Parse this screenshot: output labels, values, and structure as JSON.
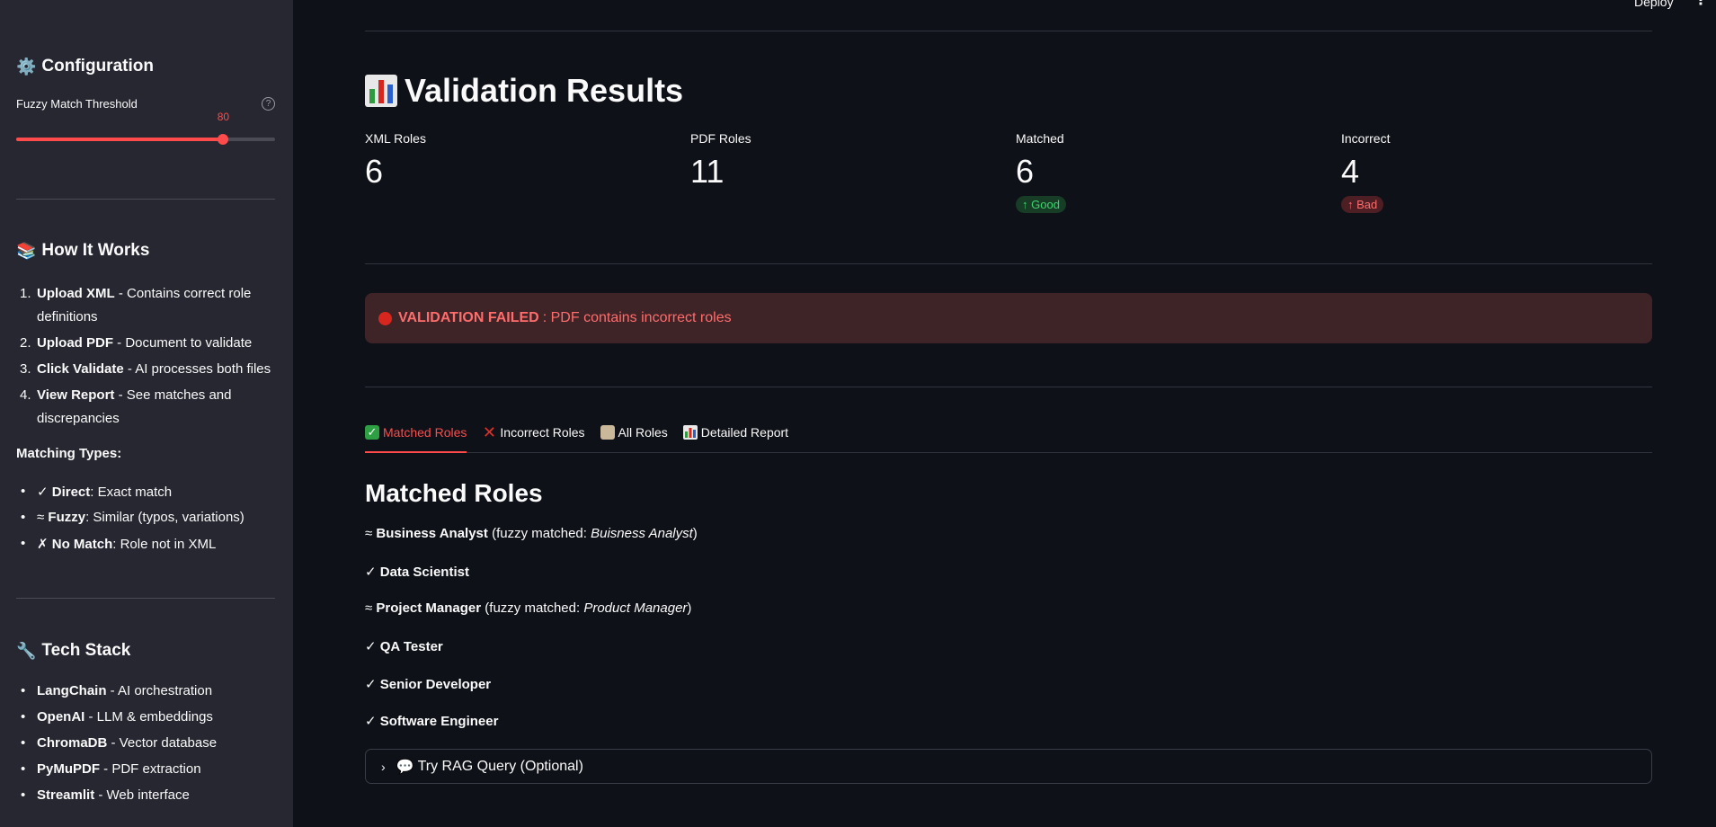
{
  "sidebar": {
    "config_title": "Configuration",
    "slider": {
      "label": "Fuzzy Match Threshold",
      "value": "80",
      "min": 0,
      "max": 100
    },
    "how_title": "How It Works",
    "steps": [
      {
        "num": "1.",
        "bold": "Upload XML",
        "rest": " - Contains correct role definitions"
      },
      {
        "num": "2.",
        "bold": "Upload PDF",
        "rest": " - Document to validate"
      },
      {
        "num": "3.",
        "bold": "Click Validate",
        "rest": " - AI processes both files"
      },
      {
        "num": "4.",
        "bold": "View Report",
        "rest": " - See matches and discrepancies"
      }
    ],
    "matching_title": "Matching Types:",
    "matching": [
      {
        "sym": "✓",
        "bold": "Direct",
        "rest": ": Exact match"
      },
      {
        "sym": "≈",
        "bold": "Fuzzy",
        "rest": ": Similar (typos, variations)"
      },
      {
        "sym": "✗",
        "bold": "No Match",
        "rest": ": Role not in XML"
      }
    ],
    "tech_title": "Tech Stack",
    "tech": [
      {
        "bold": "LangChain",
        "rest": " - AI orchestration"
      },
      {
        "bold": "OpenAI",
        "rest": " - LLM & embeddings"
      },
      {
        "bold": "ChromaDB",
        "rest": " - Vector database"
      },
      {
        "bold": "PyMuPDF",
        "rest": " - PDF extraction"
      },
      {
        "bold": "Streamlit",
        "rest": " - Web interface"
      }
    ]
  },
  "header": {
    "deploy": "Deploy",
    "menu": "⋮"
  },
  "main": {
    "title": "Validation Results",
    "metrics": [
      {
        "label": "XML Roles",
        "value": "6",
        "delta": ""
      },
      {
        "label": "PDF Roles",
        "value": "11",
        "delta": ""
      },
      {
        "label": "Matched",
        "value": "6",
        "delta": "Good",
        "delta_type": "good"
      },
      {
        "label": "Incorrect",
        "value": "4",
        "delta": "Bad",
        "delta_type": "bad"
      }
    ],
    "alert": {
      "bold": "VALIDATION FAILED",
      "rest": ": PDF contains incorrect roles"
    },
    "tabs": [
      "Matched Roles",
      "Incorrect Roles",
      "All Roles",
      "Detailed Report"
    ],
    "section_title": "Matched Roles",
    "roles": [
      {
        "sym": "≈",
        "name": "Business Analyst",
        "pre": " (fuzzy matched: ",
        "matched": "Buisness Analyst",
        "post": ")"
      },
      {
        "sym": "✓",
        "name": "Data Scientist",
        "pre": "",
        "matched": "",
        "post": ""
      },
      {
        "sym": "≈",
        "name": "Project Manager",
        "pre": " (fuzzy matched: ",
        "matched": "Product Manager",
        "post": ")"
      },
      {
        "sym": "✓",
        "name": "QA Tester",
        "pre": "",
        "matched": "",
        "post": ""
      },
      {
        "sym": "✓",
        "name": "Senior Developer",
        "pre": "",
        "matched": "",
        "post": ""
      },
      {
        "sym": "✓",
        "name": "Software Engineer",
        "pre": "",
        "matched": "",
        "post": ""
      }
    ],
    "expander": "Try RAG Query (Optional)"
  },
  "colors": {
    "accent": "#ff4b4b",
    "good": "#3dd56d",
    "bad": "#ff6b6b",
    "sidebar_bg": "#262730",
    "main_bg": "#0e1117"
  }
}
